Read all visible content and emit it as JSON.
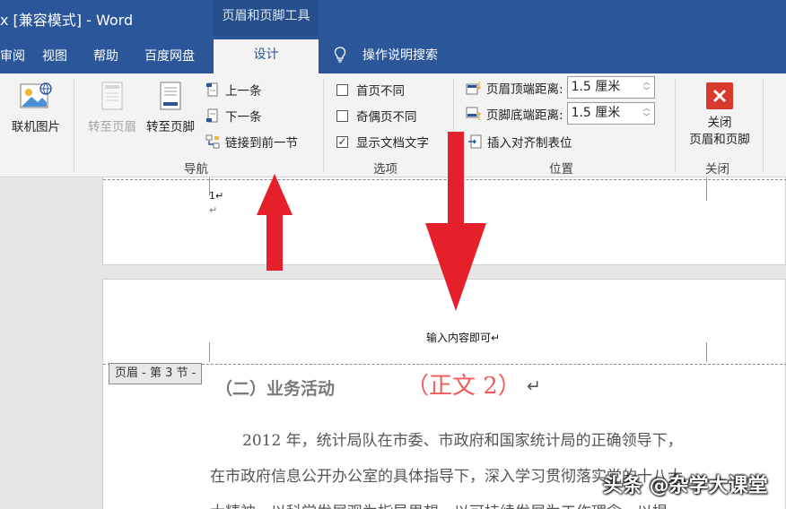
{
  "titlebar": {
    "title": "x [兼容模式]  -  Word",
    "context_tools": "页眉和页脚工具"
  },
  "tabs": {
    "items": [
      "审阅",
      "视图",
      "帮助",
      "百度网盘"
    ],
    "active": "设计",
    "tell_me": "操作说明搜索"
  },
  "ribbon": {
    "insert": {
      "online_pictures": "联机图片"
    },
    "navigation": {
      "goto_header": "转至页眉",
      "goto_footer": "转至页脚",
      "previous": "上一条",
      "next": "下一条",
      "link_to_previous": "链接到前一节",
      "label": "导航"
    },
    "options": {
      "different_first": "首页不同",
      "different_odd_even": "奇偶页不同",
      "show_document_text": "显示文档文字",
      "show_document_text_checked": true,
      "label": "选项"
    },
    "position": {
      "header_from_top": "页眉顶端距离:",
      "header_from_top_value": "1.5 厘米",
      "footer_from_bottom": "页脚底端距离:",
      "footer_from_bottom_value": "1.5 厘米",
      "insert_alignment_tab": "插入对齐制表位",
      "label": "位置"
    },
    "close": {
      "close_line1": "关闭",
      "close_line2": "页眉和页脚",
      "label": "关闭"
    }
  },
  "document": {
    "page_number": "1↵",
    "return_mark": "↵",
    "header_text": "输入内容即可↵",
    "header_tag": "页眉 - 第 3 节 -",
    "heading": "（二）业务活动",
    "annotation": "（正文 2）",
    "annotation_return": "↵",
    "para_line1": "2012 年，统计局队在市委、市政府和国家统计局的正确领导下，",
    "para_line2": "在市政府信息公开办公室的具体指导下，深入学习贯彻落实党的十八大",
    "para_line3": "大精神，以科学发展观为指导思想，以可持续发展为工作理念，以提"
  },
  "overlay": {
    "watermark": "头条 @杂学大课堂"
  },
  "colors": {
    "word_blue": "#2b579a",
    "ribbon_bg": "#f3f3f3",
    "arrow_red": "#e5202a",
    "annotation_red": "#f35a5a",
    "close_red": "#d9382d"
  }
}
